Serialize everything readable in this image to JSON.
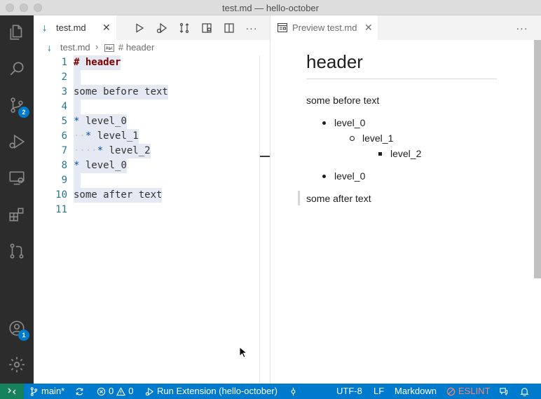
{
  "window": {
    "title": "test.md — hello-october"
  },
  "editor": {
    "tab_label": "test.md",
    "breadcrumb": {
      "file": "test.md",
      "symbol": "# header"
    },
    "lines": [
      {
        "number": "1",
        "text": "# header"
      },
      {
        "number": "2",
        "text": ""
      },
      {
        "number": "3",
        "text": "some before text"
      },
      {
        "number": "4",
        "text": ""
      },
      {
        "number": "5",
        "text": "* level_0"
      },
      {
        "number": "6",
        "text": "  * level_1"
      },
      {
        "number": "7",
        "text": "    * level_2"
      },
      {
        "number": "8",
        "text": "* level_0"
      },
      {
        "number": "9",
        "text": ""
      },
      {
        "number": "10",
        "text": "some after text"
      },
      {
        "number": "11",
        "text": ""
      }
    ]
  },
  "preview": {
    "tab_label": "Preview test.md",
    "heading": "header",
    "para_before": "some before text",
    "list": {
      "item1": "level_0",
      "item1_child": "level_1",
      "item1_grandchild": "level_2",
      "item2": "level_0"
    },
    "para_after": "some after text"
  },
  "activity": {
    "source_control_badge": "2",
    "accounts_badge": "1"
  },
  "statusbar": {
    "branch": "main*",
    "errors": "0",
    "warnings": "0",
    "run": "Run Extension (hello-october)",
    "encoding": "UTF-8",
    "eol": "LF",
    "language": "Markdown",
    "eslint": "ESLINT"
  },
  "colors": {
    "accent": "#007acc",
    "remote": "#16825d",
    "activity_bar": "#2c2c2c",
    "heading_red": "#800000",
    "line_number": "#237893"
  }
}
